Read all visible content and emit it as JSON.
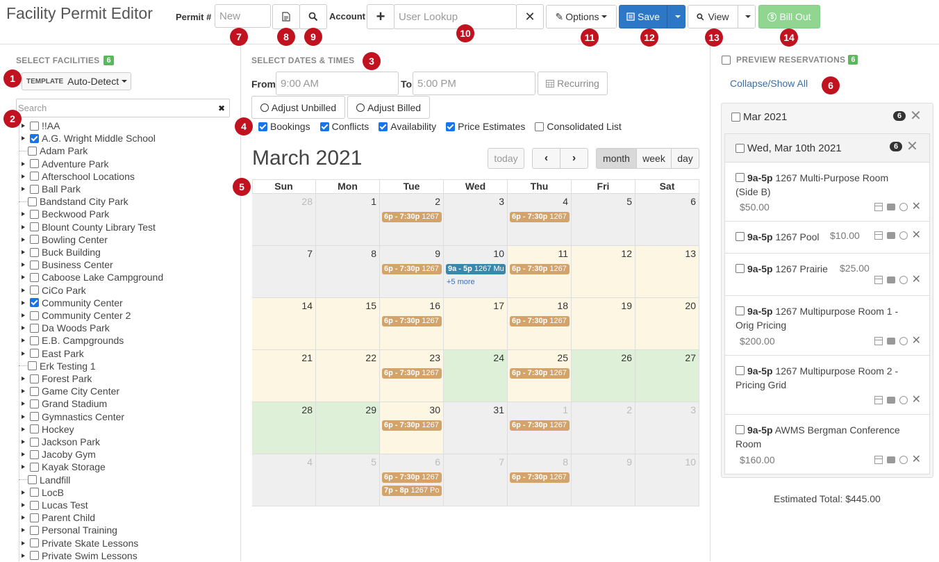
{
  "header": {
    "title": "Facility Permit Editor",
    "permit_label": "Permit #",
    "permit_placeholder": "New",
    "account_label": "Account",
    "user_lookup_placeholder": "User Lookup",
    "options_label": "Options",
    "save_label": "Save",
    "view_label": "View",
    "bill_out_label": "Bill Out"
  },
  "callouts": [
    "1",
    "2",
    "3",
    "4",
    "5",
    "6",
    "7",
    "8",
    "9",
    "10",
    "11",
    "12",
    "13",
    "14"
  ],
  "facilities": {
    "section_title": "SELECT FACILITIES",
    "count": "6",
    "template_tag": "TEMPLATE",
    "template_value": "Auto-Detect",
    "search_placeholder": "Search",
    "items": [
      {
        "name": "!!AA",
        "expandable": true,
        "checked": false
      },
      {
        "name": "A.G. Wright Middle School",
        "expandable": true,
        "checked": true
      },
      {
        "name": "Adam Park",
        "expandable": false,
        "checked": false
      },
      {
        "name": "Adventure Park",
        "expandable": true,
        "checked": false
      },
      {
        "name": "Afterschool Locations",
        "expandable": true,
        "checked": false
      },
      {
        "name": "Ball Park",
        "expandable": true,
        "checked": false
      },
      {
        "name": "Bandstand City Park",
        "expandable": false,
        "checked": false
      },
      {
        "name": "Beckwood Park",
        "expandable": true,
        "checked": false
      },
      {
        "name": "Blount County Library Test",
        "expandable": true,
        "checked": false
      },
      {
        "name": "Bowling Center",
        "expandable": true,
        "checked": false
      },
      {
        "name": "Buck Building",
        "expandable": true,
        "checked": false
      },
      {
        "name": "Business Center",
        "expandable": true,
        "checked": false
      },
      {
        "name": "Caboose Lake Campground",
        "expandable": true,
        "checked": false
      },
      {
        "name": "CiCo Park",
        "expandable": true,
        "checked": false
      },
      {
        "name": "Community Center",
        "expandable": true,
        "checked": true
      },
      {
        "name": "Community Center 2",
        "expandable": true,
        "checked": false
      },
      {
        "name": "Da Woods Park",
        "expandable": true,
        "checked": false
      },
      {
        "name": "E.B. Campgrounds",
        "expandable": true,
        "checked": false
      },
      {
        "name": "East Park",
        "expandable": true,
        "checked": false
      },
      {
        "name": "Erk Testing 1",
        "expandable": false,
        "checked": false
      },
      {
        "name": "Forest Park",
        "expandable": true,
        "checked": false
      },
      {
        "name": "Game City Center",
        "expandable": true,
        "checked": false
      },
      {
        "name": "Grand Stadium",
        "expandable": true,
        "checked": false
      },
      {
        "name": "Gymnastics Center",
        "expandable": true,
        "checked": false
      },
      {
        "name": "Hockey",
        "expandable": true,
        "checked": false
      },
      {
        "name": "Jackson Park",
        "expandable": true,
        "checked": false
      },
      {
        "name": "Jacoby Gym",
        "expandable": true,
        "checked": false
      },
      {
        "name": "Kayak Storage",
        "expandable": true,
        "checked": false
      },
      {
        "name": "Landfill",
        "expandable": false,
        "checked": false
      },
      {
        "name": "LocB",
        "expandable": true,
        "checked": false
      },
      {
        "name": "Lucas Test",
        "expandable": true,
        "checked": false
      },
      {
        "name": "Parent Child",
        "expandable": true,
        "checked": false
      },
      {
        "name": "Personal Training",
        "expandable": true,
        "checked": false
      },
      {
        "name": "Private Skate Lessons",
        "expandable": true,
        "checked": false
      },
      {
        "name": "Private Swim Lessons",
        "expandable": true,
        "checked": false
      }
    ]
  },
  "dates": {
    "section_title": "SELECT DATES & TIMES",
    "from_label": "From",
    "from_value": "9:00 AM",
    "to_label": "To",
    "to_value": "5:00 PM",
    "recurring_label": "Recurring",
    "adjust_unbilled_label": "Adjust Unbilled",
    "adjust_billed_label": "Adjust Billed",
    "filters": [
      {
        "label": "Bookings",
        "checked": true
      },
      {
        "label": "Conflicts",
        "checked": true
      },
      {
        "label": "Availability",
        "checked": true
      },
      {
        "label": "Price Estimates",
        "checked": true
      },
      {
        "label": "Consolidated List",
        "checked": false
      }
    ]
  },
  "calendar": {
    "month_title": "March 2021",
    "today_label": "today",
    "views": [
      "month",
      "week",
      "day"
    ],
    "active_view": "month",
    "weekdays": [
      "Sun",
      "Mon",
      "Tue",
      "Wed",
      "Thu",
      "Fri",
      "Sat"
    ],
    "weeks": [
      [
        {
          "d": "28",
          "o": true,
          "bg": "grey"
        },
        {
          "d": "1",
          "bg": "grey"
        },
        {
          "d": "2",
          "bg": "grey"
        },
        {
          "d": "3",
          "bg": "grey"
        },
        {
          "d": "4",
          "bg": "grey"
        },
        {
          "d": "5",
          "bg": "grey"
        },
        {
          "d": "6",
          "bg": "grey"
        }
      ],
      [
        {
          "d": "7",
          "bg": "grey"
        },
        {
          "d": "8",
          "bg": "grey"
        },
        {
          "d": "9",
          "bg": "grey"
        },
        {
          "d": "10",
          "bg": "grey"
        },
        {
          "d": "11",
          "bg": "cream"
        },
        {
          "d": "12",
          "bg": "cream"
        },
        {
          "d": "13",
          "bg": "cream"
        }
      ],
      [
        {
          "d": "14",
          "bg": "cream"
        },
        {
          "d": "15",
          "bg": "cream"
        },
        {
          "d": "16",
          "bg": "cream"
        },
        {
          "d": "17",
          "bg": "cream"
        },
        {
          "d": "18",
          "bg": "cream"
        },
        {
          "d": "19",
          "bg": "cream"
        },
        {
          "d": "20",
          "bg": "cream"
        }
      ],
      [
        {
          "d": "21",
          "bg": "cream"
        },
        {
          "d": "22",
          "bg": "cream"
        },
        {
          "d": "23",
          "bg": "cream"
        },
        {
          "d": "24",
          "bg": "green"
        },
        {
          "d": "25",
          "bg": "cream"
        },
        {
          "d": "26",
          "bg": "green"
        },
        {
          "d": "27",
          "bg": "green"
        }
      ],
      [
        {
          "d": "28",
          "bg": "green"
        },
        {
          "d": "29",
          "bg": "green"
        },
        {
          "d": "30",
          "bg": "cream"
        },
        {
          "d": "31",
          "bg": "grey"
        },
        {
          "d": "1",
          "o": true,
          "bg": "grey"
        },
        {
          "d": "2",
          "o": true,
          "bg": "grey"
        },
        {
          "d": "3",
          "o": true,
          "bg": "grey"
        }
      ],
      [
        {
          "d": "4",
          "o": true,
          "bg": "grey"
        },
        {
          "d": "5",
          "o": true,
          "bg": "grey"
        },
        {
          "d": "6",
          "o": true,
          "bg": "grey"
        },
        {
          "d": "7",
          "o": true,
          "bg": "grey"
        },
        {
          "d": "8",
          "o": true,
          "bg": "grey"
        },
        {
          "d": "9",
          "o": true,
          "bg": "grey"
        },
        {
          "d": "10",
          "o": true,
          "bg": "grey"
        }
      ]
    ],
    "events": [
      {
        "week": 0,
        "day": 2,
        "slot": 0,
        "time": "6p - 7:30p",
        "text": "1267",
        "color": "tan"
      },
      {
        "week": 0,
        "day": 4,
        "slot": 0,
        "time": "6p - 7:30p",
        "text": "1267",
        "color": "tan"
      },
      {
        "week": 1,
        "day": 2,
        "slot": 0,
        "time": "6p - 7:30p",
        "text": "1267",
        "color": "tan"
      },
      {
        "week": 1,
        "day": 3,
        "slot": 0,
        "time": "9a - 5p",
        "text": "1267 Mu",
        "color": "blue"
      },
      {
        "week": 1,
        "day": 4,
        "slot": 0,
        "time": "6p - 7:30p",
        "text": "1267",
        "color": "tan"
      },
      {
        "week": 2,
        "day": 2,
        "slot": 0,
        "time": "6p - 7:30p",
        "text": "1267",
        "color": "tan"
      },
      {
        "week": 2,
        "day": 4,
        "slot": 0,
        "time": "6p - 7:30p",
        "text": "1267",
        "color": "tan"
      },
      {
        "week": 3,
        "day": 2,
        "slot": 0,
        "time": "6p - 7:30p",
        "text": "1267",
        "color": "tan"
      },
      {
        "week": 3,
        "day": 4,
        "slot": 0,
        "time": "6p - 7:30p",
        "text": "1267",
        "color": "tan"
      },
      {
        "week": 4,
        "day": 2,
        "slot": 0,
        "time": "6p - 7:30p",
        "text": "1267",
        "color": "tan"
      },
      {
        "week": 4,
        "day": 4,
        "slot": 0,
        "time": "6p - 7:30p",
        "text": "1267",
        "color": "tan"
      },
      {
        "week": 5,
        "day": 2,
        "slot": 0,
        "time": "6p - 7:30p",
        "text": "1267",
        "color": "tan"
      },
      {
        "week": 5,
        "day": 2,
        "slot": 1,
        "time": "7p - 8p",
        "text": "1267 Po",
        "color": "tan"
      },
      {
        "week": 5,
        "day": 4,
        "slot": 0,
        "time": "6p - 7:30p",
        "text": "1267",
        "color": "tan"
      }
    ],
    "more_link": {
      "week": 1,
      "day": 3,
      "label": "+5 more"
    }
  },
  "preview": {
    "section_title": "PREVIEW RESERVATIONS",
    "count": "6",
    "collapse_label": "Collapse/Show All",
    "month_group": "Mar 2021",
    "month_count": "6",
    "day_group": "Wed, Mar 10th 2021",
    "day_count": "6",
    "items": [
      {
        "time": "9a-5p",
        "line1": "1267 Multi-Purpose Room",
        "line2": "(Side B)",
        "price": "$50.00"
      },
      {
        "time": "9a-5p",
        "line1": "1267 Pool",
        "line2": "",
        "price": "$10.00"
      },
      {
        "time": "9a-5p",
        "line1": "1267 Prairie",
        "line2": "",
        "price": "$25.00"
      },
      {
        "time": "9a-5p",
        "line1": "1267 Multipurpose Room 1 -",
        "line2": "Orig Pricing",
        "price": "$200.00"
      },
      {
        "time": "9a-5p",
        "line1": "1267 Multipurpose Room 2 -",
        "line2": "Pricing Grid",
        "price": ""
      },
      {
        "time": "9a-5p",
        "line1": "AWMS Bergman Conference",
        "line2": "Room",
        "price": "$160.00"
      }
    ],
    "estimated_total": "Estimated Total: $445.00"
  }
}
